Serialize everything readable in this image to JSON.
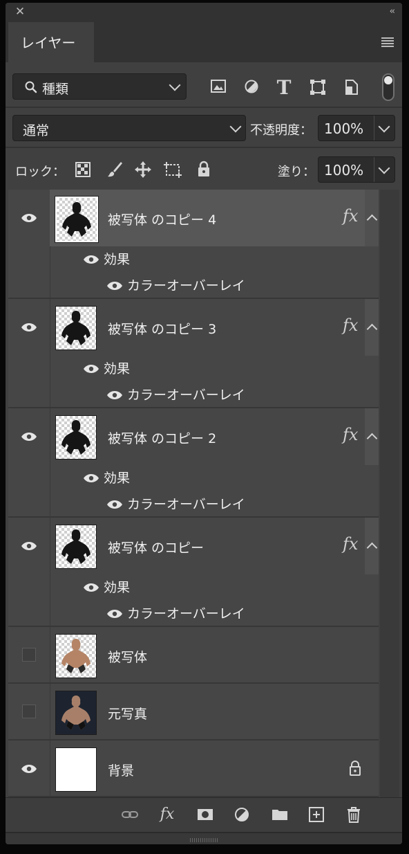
{
  "panel": {
    "title": "レイヤー"
  },
  "filter": {
    "kind_label": "種類",
    "icons": [
      "image-filter-icon",
      "adjustment-filter-icon",
      "type-filter-icon",
      "shape-filter-icon",
      "smart-object-filter-icon",
      "filter-toggle-switch"
    ]
  },
  "blend": {
    "mode": "通常",
    "opacity_label": "不透明度：",
    "opacity_value": "100%"
  },
  "lock": {
    "label": "ロック：",
    "fill_label": "塗り：",
    "fill_value": "100%"
  },
  "layers": [
    {
      "name": "被写体 のコピー 4",
      "visible": true,
      "selected": true,
      "fx": "fx",
      "effects_label": "効果",
      "effect": "カラーオーバーレイ"
    },
    {
      "name": "被写体 のコピー 3",
      "visible": true,
      "selected": false,
      "fx": "fx",
      "effects_label": "効果",
      "effect": "カラーオーバーレイ"
    },
    {
      "name": "被写体 のコピー 2",
      "visible": true,
      "selected": false,
      "fx": "fx",
      "effects_label": "効果",
      "effect": "カラーオーバーレイ"
    },
    {
      "name": "被写体 のコピー",
      "visible": true,
      "selected": false,
      "fx": "fx",
      "effects_label": "効果",
      "effect": "カラーオーバーレイ"
    },
    {
      "name": "被写体",
      "visible": false,
      "selected": false
    },
    {
      "name": "元写真",
      "visible": false,
      "selected": false
    },
    {
      "name": "背景",
      "visible": true,
      "selected": false,
      "locked": true
    }
  ],
  "footer": {
    "fx_label": "fx",
    "icons": [
      "link-layers-icon",
      "add-style-icon",
      "add-mask-icon",
      "new-adjustment-icon",
      "new-group-icon",
      "new-layer-icon",
      "delete-layer-icon"
    ]
  }
}
